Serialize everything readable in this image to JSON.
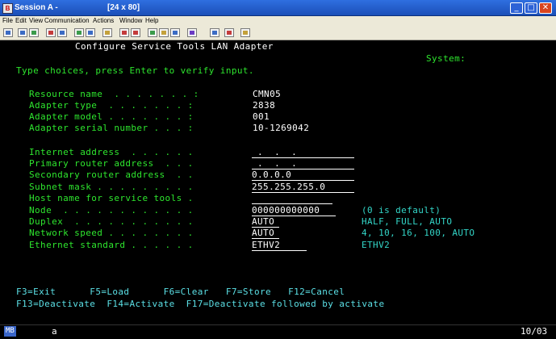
{
  "window": {
    "title": "Session A -",
    "size": "[24 x 80]"
  },
  "menu": [
    "File",
    "Edit",
    "View",
    "Communication",
    "Actions",
    "Window",
    "Help"
  ],
  "screen": {
    "title": "Configure Service Tools LAN Adapter",
    "system_label": "System:",
    "instruction": "Type choices, press Enter to verify input.",
    "info": [
      {
        "label": "Resource name  . . . . . . . :",
        "value": "CMN05"
      },
      {
        "label": "Adapter type  . . . . . . . :",
        "value": "2838"
      },
      {
        "label": "Adapter model . . . . . . . :",
        "value": "001"
      },
      {
        "label": "Adapter serial number . . . :",
        "value": "10-1269042"
      }
    ],
    "fields": [
      {
        "label": "Internet address  . . . . . .",
        "value": " .  .  .",
        "hint": ""
      },
      {
        "label": "Primary router address  . . .",
        "value": " .  .  .",
        "hint": ""
      },
      {
        "label": "Secondary router address  . .",
        "value": "0.0.0.0",
        "hint": ""
      },
      {
        "label": "Subnet mask . . . . . . . . .",
        "value": "255.255.255.0",
        "hint": ""
      },
      {
        "label": "Host name for service tools .",
        "value": "",
        "hint": ""
      },
      {
        "label": "Node  . . . . . . . . . . . .",
        "value": "000000000000",
        "hint": "(0 is default)"
      },
      {
        "label": "Duplex  . . . . . . . . . . .",
        "value": "AUTO",
        "hint": "HALF, FULL, AUTO"
      },
      {
        "label": "Network speed . . . . . . . .",
        "value": "AUTO",
        "hint": "4, 10, 16, 100, AUTO"
      },
      {
        "label": "Ethernet standard . . . . . .",
        "value": "ETHV2",
        "hint": "ETHV2"
      }
    ],
    "fkeys_line1": "F3=Exit      F5=Load      F6=Clear   F7=Store   F12=Cancel",
    "fkeys_line2": "F13=Deactivate  F14=Activate  F17=Deactivate followed by activate"
  },
  "status": {
    "indicator": "MB",
    "mode": "a",
    "cursor": "10/03"
  }
}
